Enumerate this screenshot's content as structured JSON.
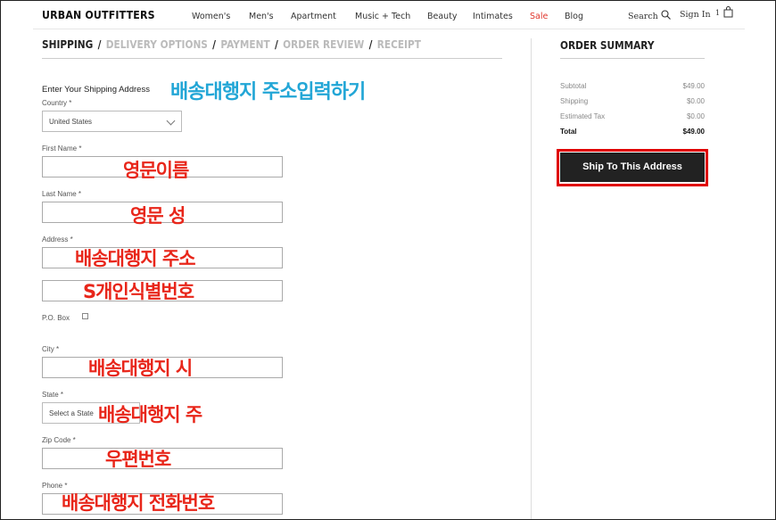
{
  "header": {
    "logo": "URBAN OUTFITTERS",
    "nav": [
      "Women's",
      "Men's",
      "Apartment",
      "Music + Tech",
      "Beauty",
      "Intimates",
      "Sale",
      "Blog"
    ],
    "search_label": "Search",
    "sign_in": "Sign In",
    "cart_count": "1"
  },
  "steps": [
    "SHIPPING",
    "DELIVERY OPTIONS",
    "PAYMENT",
    "ORDER REVIEW",
    "RECEIPT"
  ],
  "form": {
    "title": "Enter Your Shipping Address",
    "country_label": "Country *",
    "country_value": "United States",
    "first_name_label": "First Name *",
    "last_name_label": "Last Name *",
    "address_label": "Address *",
    "po_box_label": "P.O. Box",
    "city_label": "City *",
    "state_label": "State *",
    "state_value": "Select a State",
    "zip_label": "Zip Code *",
    "phone_label": "Phone *"
  },
  "annotations": {
    "title": "배송대행지 주소입력하기",
    "first_name": "영문이름",
    "last_name": "영문 성",
    "address": "배송대행지 주소",
    "address2": "S개인식별번호",
    "city": "배송대행지 시",
    "state": "배송대행지 주",
    "zip": "우편번호",
    "phone": "배송대행지 전화번호"
  },
  "summary": {
    "title": "ORDER SUMMARY",
    "rows": [
      {
        "label": "Subtotal",
        "value": "$49.00"
      },
      {
        "label": "Shipping",
        "value": "$0.00"
      },
      {
        "label": "Estimated Tax",
        "value": "$0.00"
      },
      {
        "label": "Total",
        "value": "$49.00"
      }
    ],
    "button": "Ship To This Address"
  },
  "colors": {
    "sale": "#e0352b",
    "annotation_red": "#e8261a",
    "annotation_blue": "#22a6d6",
    "highlight": "#e00000"
  }
}
